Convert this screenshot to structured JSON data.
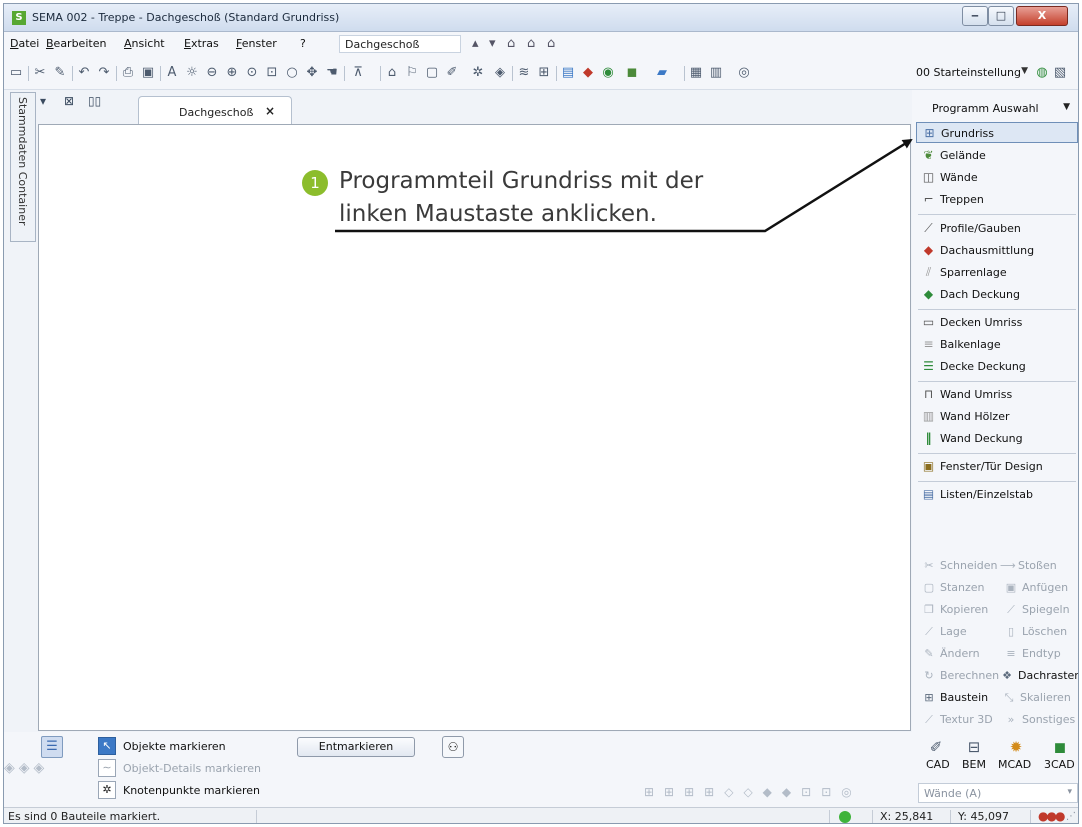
{
  "window": {
    "app_logo": "S",
    "title": "SEMA 002 - Treppe - Dachgeschoß (Standard Grundriss)",
    "controls": {
      "minimize": "‒",
      "maximize": "□",
      "close": "X"
    }
  },
  "menu": {
    "items": [
      "Datei",
      "Bearbeiten",
      "Ansicht",
      "Extras",
      "Fenster",
      "?"
    ],
    "floor_value": "Dachgeschoß"
  },
  "toolbar": {
    "preset_value": "00 Starteinstellung"
  },
  "left_strip": {
    "label": "Stammdaten Container"
  },
  "document_tab": {
    "label": "Dachgeschoß",
    "close": "×"
  },
  "callout": {
    "number": "1",
    "line1": "Programmteil Grundriss mit der",
    "line2": "linken Maustaste anklicken."
  },
  "program_panel": {
    "header": "Programm Auswahl",
    "items": [
      {
        "label": "Grundriss",
        "icon": "floorplan-icon",
        "color": "#4a6fa5"
      },
      {
        "label": "Gelände",
        "icon": "terrain-icon",
        "color": "#4c8a3a"
      },
      {
        "label": "Wände",
        "icon": "walls-icon",
        "color": "#555555"
      },
      {
        "label": "Treppen",
        "icon": "stairs-icon",
        "color": "#555555"
      },
      {
        "label": "Profile/Gauben",
        "icon": "profile-icon",
        "color": "#555555"
      },
      {
        "label": "Dachausmittlung",
        "icon": "roof-icon",
        "color": "#c0392b"
      },
      {
        "label": "Sparrenlage",
        "icon": "rafter-icon",
        "color": "#999999"
      },
      {
        "label": "Dach Deckung",
        "icon": "roofcover-icon",
        "color": "#2e8b3a"
      },
      {
        "label": "Decken Umriss",
        "icon": "ceiling-outline-icon",
        "color": "#555555"
      },
      {
        "label": "Balkenlage",
        "icon": "beams-icon",
        "color": "#999999"
      },
      {
        "label": "Decke Deckung",
        "icon": "ceiling-cover-icon",
        "color": "#2e8b3a"
      },
      {
        "label": "Wand Umriss",
        "icon": "wall-outline-icon",
        "color": "#555555"
      },
      {
        "label": "Wand Hölzer",
        "icon": "wall-timber-icon",
        "color": "#999999"
      },
      {
        "label": "Wand Deckung",
        "icon": "wall-cover-icon",
        "color": "#2e8b3a"
      },
      {
        "label": "Fenster/Tür Design",
        "icon": "window-door-icon",
        "color": "#8a6d1f"
      },
      {
        "label": "Listen/Einzelstab",
        "icon": "list-icon",
        "color": "#4a6fa5"
      }
    ],
    "edit_tools": [
      "Schneiden",
      "Stoßen",
      "Stanzen",
      "Anfügen",
      "Kopieren",
      "Spiegeln",
      "Lage",
      "Löschen",
      "Ändern",
      "Endtyp",
      "Berechnen",
      "Dachraster",
      "Baustein",
      "Skalieren",
      "Textur 3D",
      "Sonstiges"
    ],
    "modes": [
      "CAD",
      "BEM",
      "MCAD",
      "3CAD"
    ],
    "walls_select": "Wände (A)"
  },
  "selection": {
    "mark_objects": "Objekte markieren",
    "mark_details": "Objekt-Details markieren",
    "mark_nodes": "Knotenpunkte markieren",
    "unmark_button": "Entmarkieren"
  },
  "status": {
    "message": "Es sind 0 Bauteile markiert.",
    "x": "X: 25,841",
    "y": "Y: 45,097",
    "indicator_color": "#3fb33b"
  }
}
